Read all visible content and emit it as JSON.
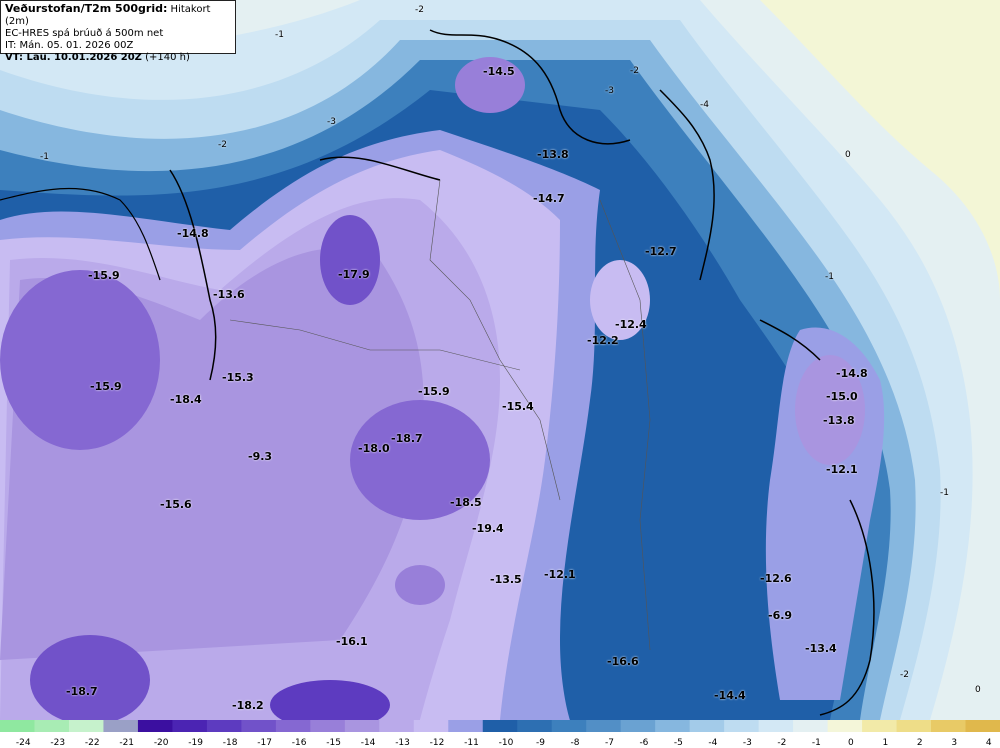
{
  "header": {
    "title": "Veðurstofan/T2m 500grid:",
    "subtitle": "Hitakort (2m)",
    "model": "EC-HRES spá brúuð á 500m net",
    "init_label": "IT: Mán. 05. 01. 2026 00Z",
    "valid_label": "VT: Lau. 10.01.2026 20Z",
    "lead": "(+140 h)"
  },
  "colorbar": {
    "ticks": [
      "-24",
      "-23",
      "-22",
      "-21",
      "-20",
      "-19",
      "-18",
      "-17",
      "-16",
      "-15",
      "-14",
      "-13",
      "-12",
      "-11",
      "-10",
      "-9",
      "-8",
      "-7",
      "-6",
      "-5",
      "-4",
      "-3",
      "-2",
      "-1",
      "0",
      "1",
      "2",
      "3",
      "4"
    ],
    "colors": [
      "#8fe8a0",
      "#a8ecb4",
      "#c6f2cc",
      "#9aa0c6",
      "#3b0fa0",
      "#4b24b3",
      "#5d3bc0",
      "#7152c9",
      "#8568d2",
      "#987fd9",
      "#a995e0",
      "#baaaea",
      "#c8bcf2",
      "#9a9fe6",
      "#1f5fa8",
      "#2d6fb2",
      "#3d80bd",
      "#528fc6",
      "#6aa2d2",
      "#86b7df",
      "#a3cbe9",
      "#bedcf1",
      "#d3e8f5",
      "#e4f0f2",
      "#f4f6d9",
      "#f2eaa8",
      "#eedd88",
      "#e8ca66",
      "#e0b84c"
    ]
  },
  "legend_text": {
    "minus1": "-1",
    "zero": "0",
    "minus2": "-2",
    "minus3": "-3",
    "minus4": "-4"
  },
  "point_labels": [
    {
      "id": "p1",
      "v": "-14.5"
    },
    {
      "id": "p2",
      "v": "-13.8"
    },
    {
      "id": "p3",
      "v": "-14.7"
    },
    {
      "id": "p4",
      "v": "-14.8"
    },
    {
      "id": "p5",
      "v": "-15.9"
    },
    {
      "id": "p6",
      "v": "-13.6"
    },
    {
      "id": "p7",
      "v": "-17.9"
    },
    {
      "id": "p8",
      "v": "-12.7"
    },
    {
      "id": "p9",
      "v": "-12.4"
    },
    {
      "id": "p10",
      "v": "-12.2"
    },
    {
      "id": "p11",
      "v": "-15.9"
    },
    {
      "id": "p12",
      "v": "-15.3"
    },
    {
      "id": "p13",
      "v": "-18.4"
    },
    {
      "id": "p14",
      "v": "-15.9"
    },
    {
      "id": "p15",
      "v": "-15.4"
    },
    {
      "id": "p16",
      "v": "-18.7"
    },
    {
      "id": "p17",
      "v": "-18.0"
    },
    {
      "id": "p18",
      "v": "-9.3"
    },
    {
      "id": "p19",
      "v": "-14.8"
    },
    {
      "id": "p20",
      "v": "-15.0"
    },
    {
      "id": "p21",
      "v": "-13.8"
    },
    {
      "id": "p22",
      "v": "-12.1"
    },
    {
      "id": "p23",
      "v": "-18.5"
    },
    {
      "id": "p24",
      "v": "-15.6"
    },
    {
      "id": "p25",
      "v": "-19.4"
    },
    {
      "id": "p26",
      "v": "-13.5"
    },
    {
      "id": "p27",
      "v": "-12.1"
    },
    {
      "id": "p28",
      "v": "-12.6"
    },
    {
      "id": "p29",
      "v": "-6.9"
    },
    {
      "id": "p30",
      "v": "-16.1"
    },
    {
      "id": "p31",
      "v": "-13.4"
    },
    {
      "id": "p32",
      "v": "-16.6"
    },
    {
      "id": "p33",
      "v": "-18.7"
    },
    {
      "id": "p34",
      "v": "-18.2"
    },
    {
      "id": "p35",
      "v": "-14.4"
    }
  ]
}
